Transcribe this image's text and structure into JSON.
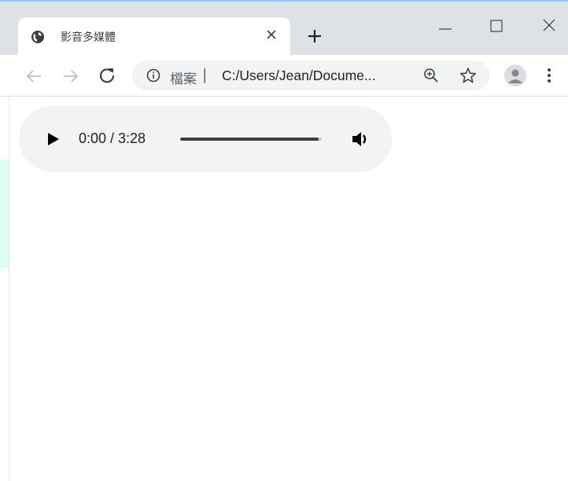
{
  "browser": {
    "tab": {
      "title": "影音多媒體",
      "favicon": "globe-icon",
      "close": "close-icon"
    },
    "new_tab": "plus-icon",
    "window_controls": [
      "minimize-icon",
      "maximize-icon",
      "close-icon"
    ],
    "toolbar": {
      "back": "back-arrow-icon",
      "forward": "forward-arrow-icon",
      "reload": "reload-icon",
      "omnibox": {
        "info_icon": "info-icon",
        "chip": "檔案",
        "separator": "|",
        "url": "C:/Users/Jean/Docume...",
        "zoom_icon": "zoom-icon",
        "star_icon": "star-icon"
      },
      "profile": "avatar-icon",
      "menu": "menu-icon"
    },
    "colors": {
      "tabstrip": "#dee1e6",
      "tab_active": "#ffffff",
      "omnibox": "#f1f3f4",
      "player": "#f1f3f4"
    }
  },
  "audio_player": {
    "state": "paused",
    "current_time": "0:00",
    "duration": "3:28",
    "time_display": "0:00 / 3:28",
    "progress_fraction": 0.98,
    "play_icon": "play-icon",
    "volume_icon": "volume-icon"
  }
}
